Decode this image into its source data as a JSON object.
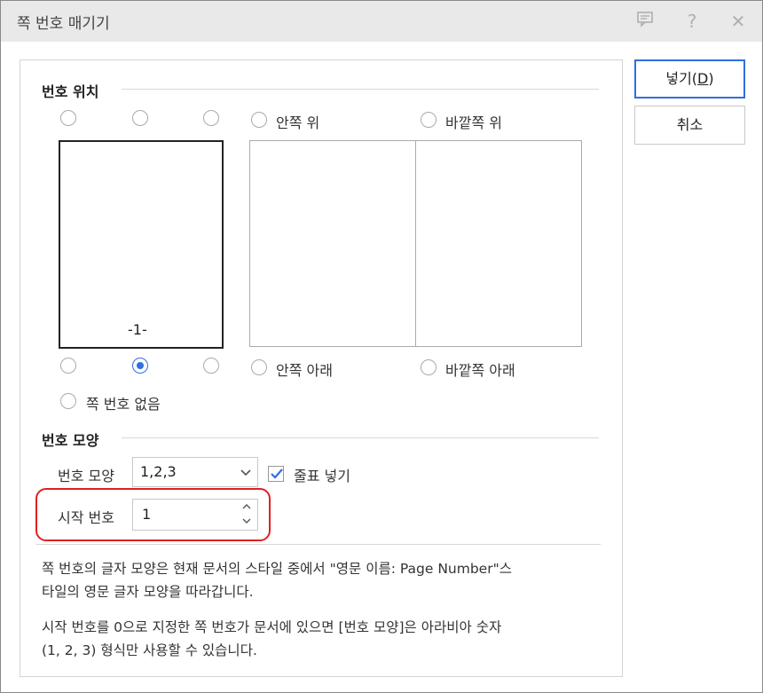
{
  "window": {
    "title": "쪽 번호 매기기"
  },
  "titlebar_icons": [
    "comment-icon",
    "help-icon",
    "close-icon"
  ],
  "position_group": {
    "label": "번호 위치",
    "inside_top": "안쪽 위",
    "outside_top": "바깥쪽 위",
    "inside_bottom": "안쪽 아래",
    "outside_bottom": "바깥쪽 아래",
    "no_number": "쪽 번호 없음",
    "preview_number": "-1-",
    "selected": "bottom-center"
  },
  "format_group": {
    "label": "번호 모양",
    "format_label": "번호 모양",
    "format_value": "1,2,3",
    "dash_label": "줄표 넣기",
    "dash_checked": true,
    "start_label": "시작 번호",
    "start_value": "1"
  },
  "notes": {
    "line1": "쪽 번호의 글자 모양은 현재 문서의 스타일 중에서 \"영문 이름: Page Number\"스",
    "line2": "타일의 영문 글자 모양을 따라갑니다.",
    "line3": "시작 번호를 0으로 지정한 쪽 번호가 문서에 있으면 [번호 모양]은 아라비아 숫자",
    "line4": "(1, 2, 3) 형식만 사용할 수 있습니다."
  },
  "buttons": {
    "insert": "넣기(D)",
    "cancel": "취소"
  },
  "colors": {
    "accent": "#2f6fe0",
    "highlight": "#e02020"
  }
}
